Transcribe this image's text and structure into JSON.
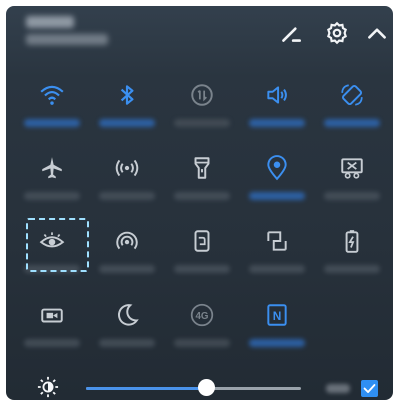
{
  "header": {
    "edit_icon": "pencil-icon",
    "settings_icon": "gear-icon",
    "collapse_icon": "chevron-up-icon"
  },
  "tiles": [
    {
      "id": "wifi",
      "icon": "wifi-icon",
      "state": "on"
    },
    {
      "id": "bluetooth",
      "icon": "bluetooth-icon",
      "state": "on"
    },
    {
      "id": "data",
      "icon": "mobile-data-icon",
      "state": "dim"
    },
    {
      "id": "sound",
      "icon": "speaker-icon",
      "state": "on"
    },
    {
      "id": "auto-rotate",
      "icon": "rotate-icon",
      "state": "on"
    },
    {
      "id": "airplane",
      "icon": "airplane-icon",
      "state": "off"
    },
    {
      "id": "hotspot",
      "icon": "hotspot-icon",
      "state": "off"
    },
    {
      "id": "flashlight",
      "icon": "flashlight-icon",
      "state": "off"
    },
    {
      "id": "location",
      "icon": "location-icon",
      "state": "on"
    },
    {
      "id": "screenshot",
      "icon": "screenshot-icon",
      "state": "off"
    },
    {
      "id": "eye-comfort",
      "icon": "eye-icon",
      "state": "off"
    },
    {
      "id": "nfc-share",
      "icon": "wireless-share-icon",
      "state": "off"
    },
    {
      "id": "screen-projection",
      "icon": "projection-icon",
      "state": "off"
    },
    {
      "id": "multi-screen",
      "icon": "multi-screen-icon",
      "state": "off"
    },
    {
      "id": "power-saving",
      "icon": "battery-icon",
      "state": "off"
    },
    {
      "id": "screen-recorder",
      "icon": "screen-recorder-icon",
      "state": "off"
    },
    {
      "id": "do-not-disturb",
      "icon": "moon-icon",
      "state": "off"
    },
    {
      "id": "4g",
      "icon": "4g-icon",
      "state": "dim",
      "badge": "4G"
    },
    {
      "id": "nfc",
      "icon": "nfc-icon",
      "state": "on",
      "badge": "N"
    }
  ],
  "highlighted_tile": "eye-comfort",
  "brightness": {
    "icon": "brightness-icon",
    "level": 0.56,
    "auto_checked": true
  },
  "colors": {
    "accent": "#3b8ff0",
    "highlight": "#9fe0ff"
  }
}
